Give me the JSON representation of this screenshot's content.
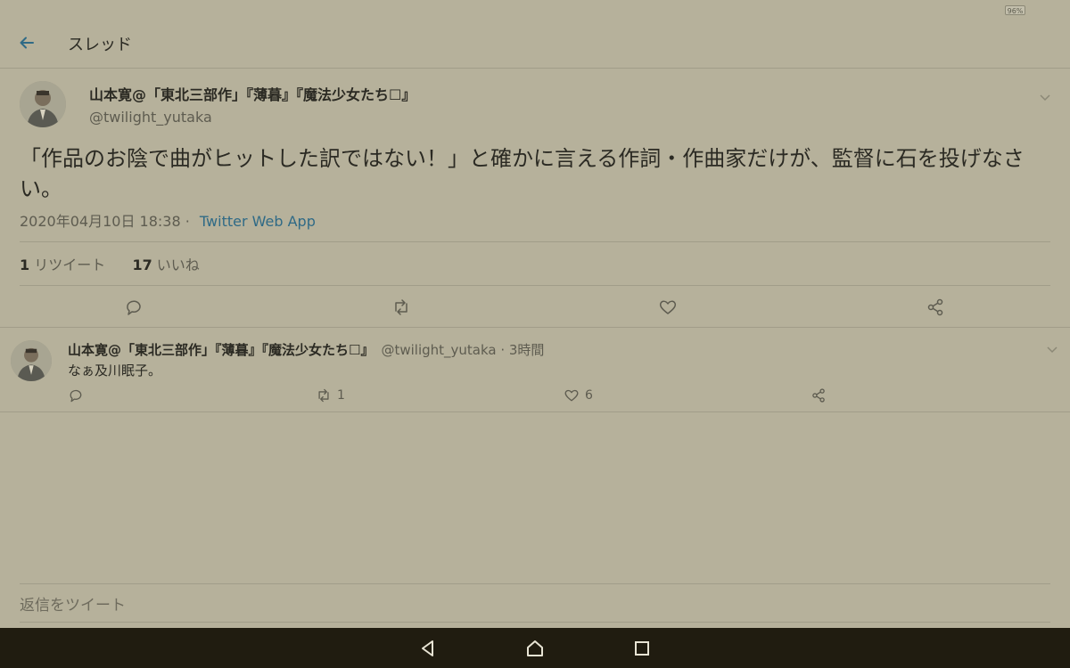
{
  "status_bar": {
    "battery": "96%"
  },
  "header": {
    "title": "スレッド"
  },
  "main_tweet": {
    "author_name": "山本寛@「東北三部作」『薄暮』『魔法少女たち☐』",
    "handle": "@twilight_yutaka",
    "text": "「作品のお陰で曲がヒットした訳ではない！」と確かに言える作詞・作曲家だけが、監督に石を投げなさい。",
    "timestamp": "2020年04月10日 18:38 ·",
    "source": "Twitter Web App",
    "retweet_count": "1",
    "retweet_label": "リツイート",
    "like_count": "17",
    "like_label": "いいね"
  },
  "reply_tweet": {
    "author_name": "山本寛@「東北三部作」『薄暮』『魔法少女たち☐』",
    "handle": "@twilight_yutaka · 3時間",
    "text": "なぁ及川眠子。",
    "retweet_count": "1",
    "like_count": "6"
  },
  "compose": {
    "placeholder": "返信をツイート"
  },
  "colors": {
    "background": "#b6b19b",
    "accent": "#2f6a86",
    "text": "#2b2a23",
    "muted": "#5e5c50",
    "navbar": "#201c10"
  },
  "icons": [
    "back-arrow-icon",
    "chevron-down-icon",
    "reply-icon",
    "retweet-icon",
    "like-icon",
    "share-icon",
    "nav-back-icon",
    "nav-home-icon",
    "nav-recents-icon"
  ]
}
